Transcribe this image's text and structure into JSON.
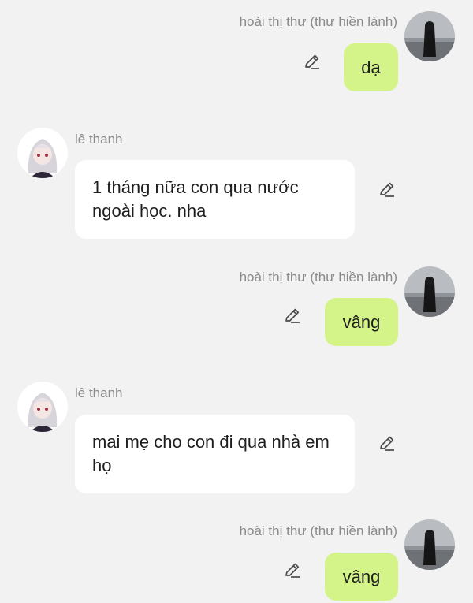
{
  "messages": [
    {
      "side": "out",
      "sender": "hoài thị thư (thư hiền lành)",
      "text": "dạ"
    },
    {
      "side": "in",
      "sender": "lê thanh",
      "text": "1 tháng nữa con qua nước ngoài học. nha"
    },
    {
      "side": "out",
      "sender": "hoài thị thư (thư hiền lành)",
      "text": "vâng"
    },
    {
      "side": "in",
      "sender": "lê thanh",
      "text": "mai mẹ cho con đi qua nhà em họ"
    },
    {
      "side": "out",
      "sender": "hoài thị thư (thư hiền lành)",
      "text": "vâng"
    }
  ],
  "icons": {
    "edit": "pencil-icon",
    "avatar_out": "avatar-dark-hair-girl",
    "avatar_in": "avatar-anime-white-hair-girl"
  },
  "colors": {
    "background": "#f2f2f2",
    "bubble_out": "#d4f48a",
    "bubble_in": "#ffffff",
    "sender_name": "#8a8a8a",
    "text": "#1e1e1e"
  }
}
